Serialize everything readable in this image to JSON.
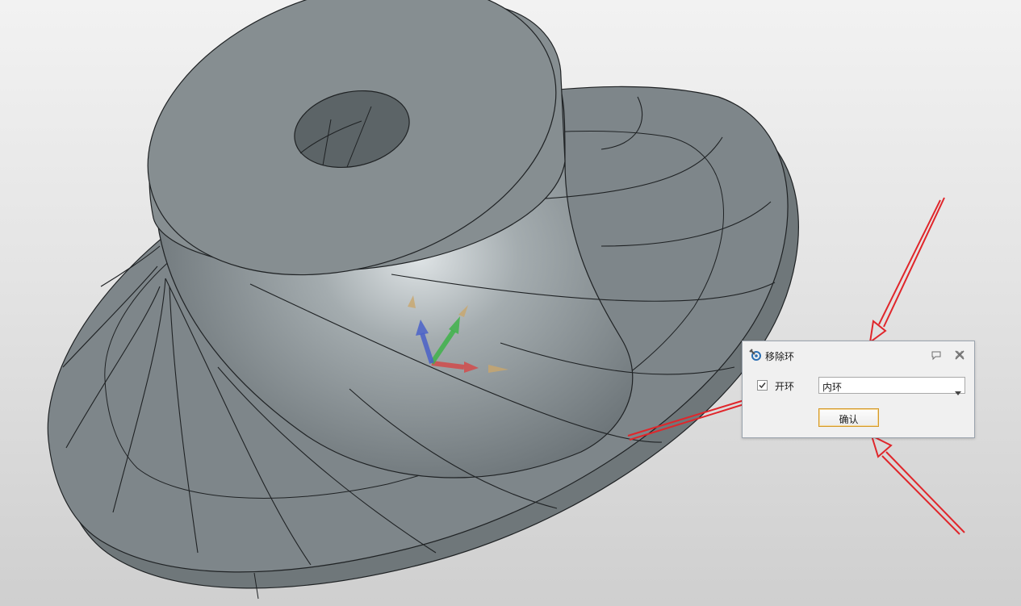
{
  "dialog": {
    "title": "移除环",
    "app_icon": "wrench-gear-icon",
    "pin_icon": "pin-icon",
    "close_icon": "close-icon",
    "open_ring": {
      "label": "开环",
      "checked": true
    },
    "ring_type": {
      "selected": "内环"
    },
    "confirm_label": "确认"
  },
  "annotations": {
    "arrow_color": "#e0262b",
    "count": 3
  },
  "model": {
    "part": "impeller",
    "surface_color": "#7e868a",
    "edge_color": "#1f2224"
  },
  "triad": {
    "x_color": "#d24b4b",
    "y_color": "#3fb34a",
    "z_color": "#4a61c9"
  }
}
